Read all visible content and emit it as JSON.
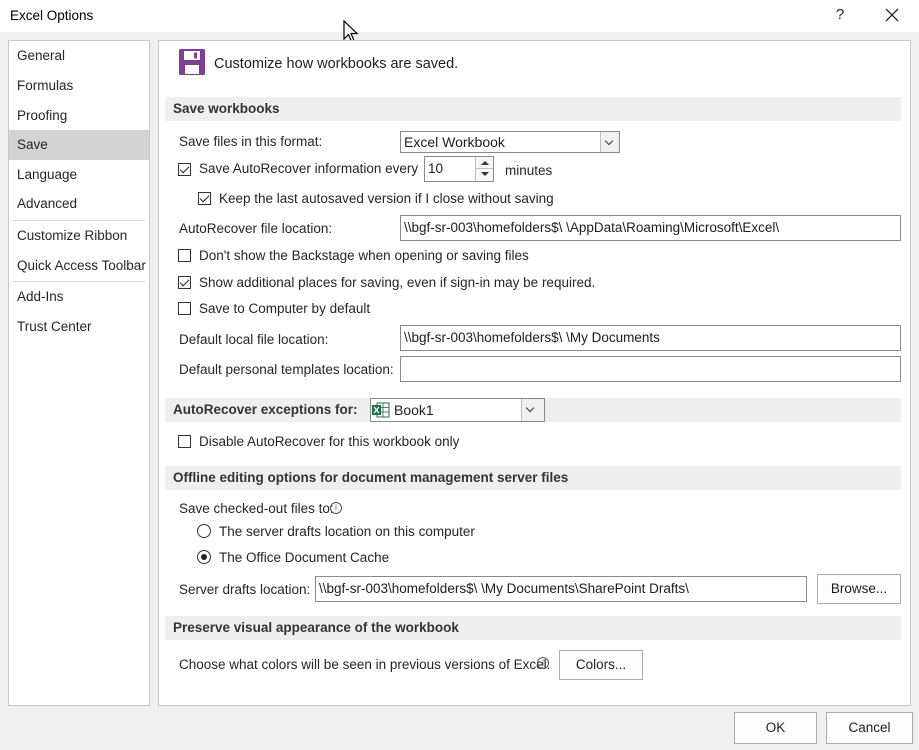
{
  "window": {
    "title": "Excel Options",
    "help_label": "?",
    "close_label": "✕"
  },
  "sidebar": {
    "items": [
      {
        "label": "General"
      },
      {
        "label": "Formulas"
      },
      {
        "label": "Proofing"
      },
      {
        "label": "Save",
        "selected": true
      },
      {
        "label": "Language"
      },
      {
        "label": "Advanced"
      },
      {
        "label": "Customize Ribbon"
      },
      {
        "label": "Quick Access Toolbar"
      },
      {
        "label": "Add-Ins"
      },
      {
        "label": "Trust Center"
      }
    ]
  },
  "header": {
    "icon": "floppy-disk-save-icon",
    "text": "Customize how workbooks are saved."
  },
  "save_workbooks": {
    "title": "Save workbooks",
    "format_label": "Save files in this format:",
    "format_value": "Excel Workbook",
    "autorecover_label": "Save AutoRecover information every",
    "autorecover_checked": true,
    "autorecover_minutes": "10",
    "minutes_label": "minutes",
    "keep_last_label": "Keep the last autosaved version if I close without saving",
    "keep_last_checked": true,
    "ar_location_label": "AutoRecover file location:",
    "ar_location_value": "\\\\bgf-sr-003\\homefolders$\\                    \\AppData\\Roaming\\Microsoft\\Excel\\",
    "dont_show_backstage_label": "Don't show the Backstage when opening or saving files",
    "dont_show_backstage_checked": false,
    "show_additional_label": "Show additional places for saving, even if sign-in may be required.",
    "show_additional_checked": true,
    "save_to_computer_label": "Save to Computer by default",
    "save_to_computer_checked": false,
    "default_local_label": "Default local file location:",
    "default_local_value": "\\\\bgf-sr-003\\homefolders$\\                    \\My Documents",
    "default_templates_label": "Default personal templates location:",
    "default_templates_value": ""
  },
  "autorecover_exceptions": {
    "title": "AutoRecover exceptions for:",
    "workbook_value": "Book1",
    "workbook_icon": "excel-icon",
    "disable_label": "Disable AutoRecover for this workbook only",
    "disable_checked": false
  },
  "offline": {
    "title": "Offline editing options for document management server files",
    "save_checked_out_label": "Save checked-out files to:",
    "option_server_label": "The server drafts location on this computer",
    "option_cache_label": "The Office Document Cache",
    "selected_option": "cache",
    "server_drafts_label": "Server drafts location:",
    "server_drafts_value": "\\\\bgf-sr-003\\homefolders$\\                        \\My Documents\\SharePoint Drafts\\",
    "browse_label": "Browse..."
  },
  "visual": {
    "title": "Preserve visual appearance of the workbook",
    "colors_question": "Choose what colors will be seen in previous versions of Excel:",
    "colors_button": "Colors..."
  },
  "footer": {
    "ok_label": "OK",
    "cancel_label": "Cancel"
  },
  "colors": {
    "accent_purple": "#7e3f97",
    "excel_green": "#1e7145",
    "selected_nav": "#d3d3d3"
  }
}
